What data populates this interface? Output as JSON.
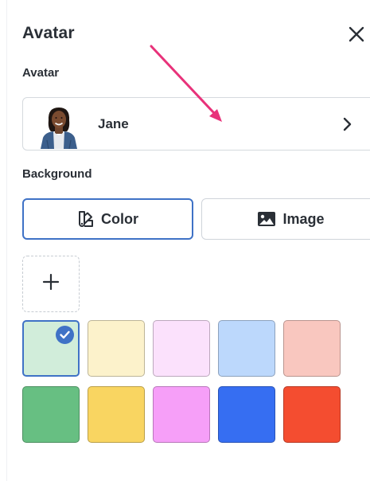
{
  "header": {
    "title": "Avatar",
    "close_icon": "close-icon"
  },
  "avatar": {
    "section_label": "Avatar",
    "name": "Jane",
    "chevron_icon": "chevron-right-icon"
  },
  "background": {
    "section_label": "Background",
    "tabs": [
      {
        "label": "Color",
        "icon": "palette-icon",
        "selected": true
      },
      {
        "label": "Image",
        "icon": "image-icon",
        "selected": false
      }
    ],
    "add_icon": "plus-icon"
  },
  "colors": {
    "accent": "#3f72c6",
    "row1": [
      "#d1edda",
      "#fcf2cb",
      "#fbe1fc",
      "#bcd8fc",
      "#f9c7bf"
    ],
    "row2": [
      "#67bf82",
      "#f9d561",
      "#f69ff8",
      "#366ef2",
      "#f44d30"
    ],
    "selected_swatch": "#d1edda"
  }
}
